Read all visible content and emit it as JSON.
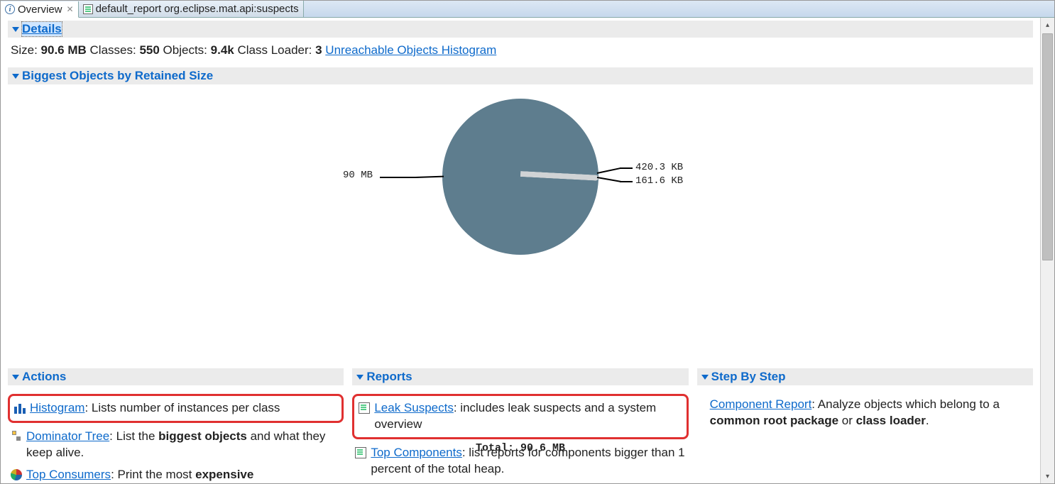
{
  "tabs": [
    {
      "label": "Overview",
      "active": true
    },
    {
      "label": "default_report  org.eclipse.mat.api:suspects",
      "active": false
    }
  ],
  "sections": {
    "details": {
      "title": "Details",
      "size_label": "Size:",
      "size_value": "90.6 MB",
      "classes_label": "Classes:",
      "classes_value": "550",
      "objects_label": "Objects:",
      "objects_value": "9.4k",
      "classloader_label": "Class Loader:",
      "classloader_value": "3",
      "link": "Unreachable Objects Histogram"
    },
    "biggest": {
      "title": "Biggest Objects by Retained Size",
      "total": "Total: 90.6 MB",
      "labels": {
        "main": "90 MB",
        "small1": "420.3 KB",
        "small2": "161.6 KB"
      }
    },
    "actions": {
      "title": "Actions",
      "items": [
        {
          "link": "Histogram",
          "rest": ": Lists number of instances per class",
          "icon": "hist",
          "hl": true
        },
        {
          "link": "Dominator Tree",
          "rest": ": List the ",
          "bold1": "biggest objects",
          "rest2": " and what they keep alive.",
          "icon": "tree"
        },
        {
          "link": "Top Consumers",
          "rest": ": Print the most ",
          "bold1": "expensive",
          "rest2": "",
          "icon": "pie"
        }
      ]
    },
    "reports": {
      "title": "Reports",
      "items": [
        {
          "link": "Leak Suspects",
          "rest": ": includes leak suspects and a system overview",
          "icon": "doc",
          "hl": true
        },
        {
          "link": "Top Components",
          "rest": ": list reports for components bigger than 1 percent of the total heap.",
          "icon": "doc"
        }
      ]
    },
    "step": {
      "title": "Step By Step",
      "items": [
        {
          "link": "Component Report",
          "rest": ": Analyze objects which belong to a ",
          "bold1": "common root package",
          "rest2": " or ",
          "bold2": "class loader",
          "rest3": "."
        }
      ]
    }
  },
  "chart_data": {
    "type": "pie",
    "title": "Biggest Objects by Retained Size",
    "total_label": "Total: 90.6 MB",
    "total_value_mb": 90.6,
    "slices": [
      {
        "label": "90 MB",
        "value_mb": 90.0
      },
      {
        "label": "420.3 KB",
        "value_mb": 0.4104
      },
      {
        "label": "161.6 KB",
        "value_mb": 0.1578
      }
    ]
  }
}
